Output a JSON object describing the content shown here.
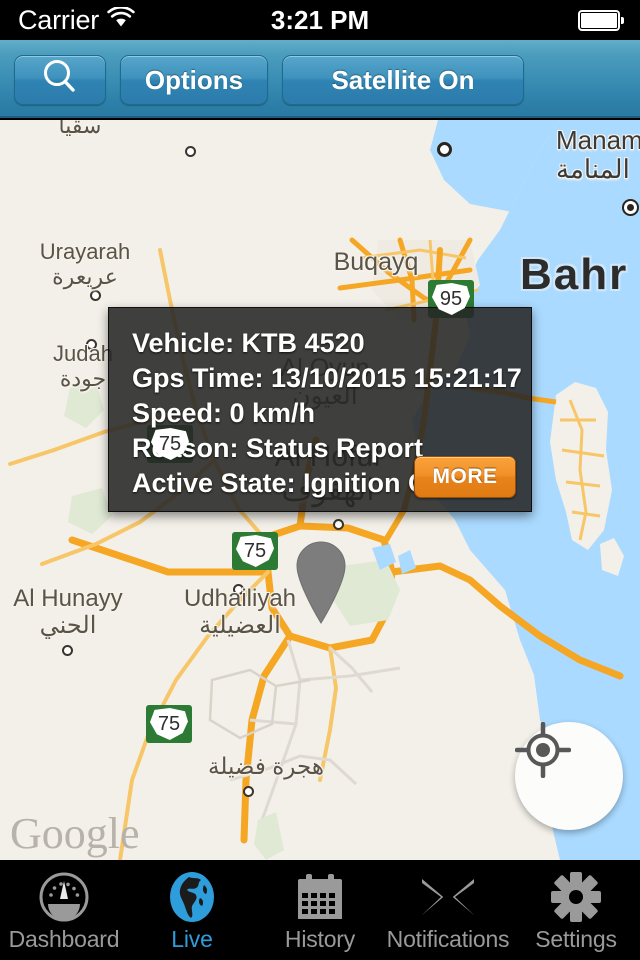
{
  "status_bar": {
    "carrier": "Carrier",
    "wifi_icon": "wifi-icon",
    "time": "3:21 PM",
    "battery_icon": "battery-full-icon"
  },
  "toolbar": {
    "search_icon": "search-icon",
    "search_label": "",
    "options_label": "Options",
    "satellite_label": "Satellite On",
    "accent_color": "#3b8fb4"
  },
  "map": {
    "provider_watermark": "Google",
    "locate_icon": "my-location-icon",
    "marker_icon": "map-pin-icon",
    "region_label": "Bahr",
    "land_color": "#f3f0e9",
    "water_color": "#aadaff",
    "road_color": "#f5a623",
    "labels": [
      {
        "en": "Urayarah",
        "ar": "عريعرة"
      },
      {
        "en": "Judah",
        "ar": "جودة"
      },
      {
        "en": "Manama",
        "ar": "المنامة"
      },
      {
        "en": "Buqayq",
        "ar": ""
      },
      {
        "en": "Al Oyun",
        "ar": "العيون"
      },
      {
        "en": "Al Hofuf",
        "ar": "الهفوف"
      },
      {
        "en": "Al Hunayy",
        "ar": "الحني"
      },
      {
        "en": "Udhailiyah",
        "ar": "العضيلية"
      },
      {
        "en": "",
        "ar": "هجرة فضيلة"
      },
      {
        "en": "",
        "ar": "سقيا"
      }
    ],
    "route_shields": [
      "95",
      "75",
      "75",
      "75"
    ]
  },
  "callout": {
    "lines": [
      "Vehicle: KTB 4520",
      "Gps Time: 13/10/2015 15:21:17",
      "Speed: 0 km/h",
      "Reason: Status Report",
      "Active State: Ignition Off"
    ],
    "vehicle": "KTB 4520",
    "gps_time": "13/10/2015 15:21:17",
    "speed": "0 km/h",
    "reason": "Status Report",
    "active_state": "Ignition Off",
    "more_label": "MORE",
    "more_color": "#ef8a1c"
  },
  "tab_bar": {
    "active_color": "#2e9ddb",
    "inactive_color": "#9a9a9a",
    "items": [
      {
        "label": "Dashboard",
        "icon": "gauge-icon",
        "active": false
      },
      {
        "label": "Live",
        "icon": "globe-icon",
        "active": true
      },
      {
        "label": "History",
        "icon": "calendar-icon",
        "active": false
      },
      {
        "label": "Notifications",
        "icon": "envelope-icon",
        "active": false
      },
      {
        "label": "Settings",
        "icon": "gear-icon",
        "active": false
      }
    ]
  }
}
